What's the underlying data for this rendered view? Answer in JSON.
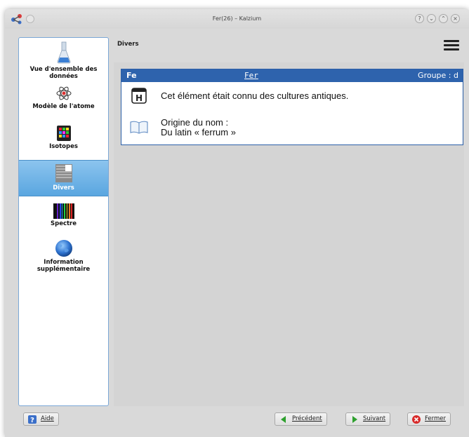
{
  "window": {
    "title": "Fer(26) – Kalzium"
  },
  "sidebar": {
    "items": [
      {
        "label": "Vue d'ensemble des données",
        "icon": "flask-icon"
      },
      {
        "label": "Modèle de l'atome",
        "icon": "atom-icon"
      },
      {
        "label": "Isotopes",
        "icon": "isotopes-icon"
      },
      {
        "label": "Divers",
        "icon": "divers-icon",
        "selected": true
      },
      {
        "label": "Spectre",
        "icon": "spectrum-icon"
      },
      {
        "label": "Information supplémentaire",
        "icon": "globe-icon"
      }
    ]
  },
  "page": {
    "header": "Divers",
    "element": {
      "symbol": "Fe",
      "name": "Fer",
      "group": "Groupe : d"
    },
    "discovery_text": "Cet élément était connu des cultures antiques.",
    "origin_label": "Origine du nom :",
    "origin_value": "Du latin « ferrum »",
    "icons": [
      "history-icon",
      "book-icon"
    ]
  },
  "buttons": {
    "help": "Aide",
    "previous": "Précédent",
    "next": "Suivant",
    "close": "Fermer"
  },
  "colors": {
    "accent": "#2e63ad",
    "selection": "#5aa6e0"
  }
}
